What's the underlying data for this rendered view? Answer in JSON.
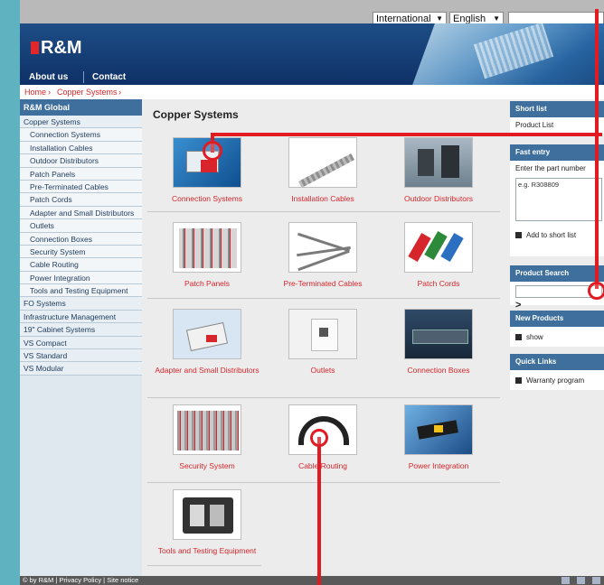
{
  "top_bar": {
    "language_region": "International",
    "language": "English"
  },
  "header": {
    "logo": "R&M",
    "nav": [
      "About us",
      "Contact"
    ]
  },
  "breadcrumb": [
    "Home",
    "Copper Systems"
  ],
  "left_nav": {
    "title": "R&M Global",
    "items": [
      {
        "label": "Copper Systems",
        "level": 1
      },
      {
        "label": "Connection Systems",
        "level": 2
      },
      {
        "label": "Installation Cables",
        "level": 2
      },
      {
        "label": "Outdoor Distributors",
        "level": 2
      },
      {
        "label": "Patch Panels",
        "level": 2
      },
      {
        "label": "Pre-Terminated Cables",
        "level": 2
      },
      {
        "label": "Patch Cords",
        "level": 2
      },
      {
        "label": "Adapter and Small Distributors",
        "level": 2
      },
      {
        "label": "Outlets",
        "level": 2
      },
      {
        "label": "Connection Boxes",
        "level": 2
      },
      {
        "label": "Security System",
        "level": 2
      },
      {
        "label": "Cable Routing",
        "level": 2
      },
      {
        "label": "Power Integration",
        "level": 2
      },
      {
        "label": "Tools and Testing Equipment",
        "level": 2
      },
      {
        "label": "FO Systems",
        "level": 1
      },
      {
        "label": "Infrastructure Management",
        "level": 1
      },
      {
        "label": "19\" Cabinet Systems",
        "level": 1
      },
      {
        "label": "VS Compact",
        "level": 1
      },
      {
        "label": "VS Standard",
        "level": 1
      },
      {
        "label": "VS Modular",
        "level": 1
      }
    ]
  },
  "main": {
    "title": "Copper Systems",
    "products": [
      {
        "label": "Connection Systems"
      },
      {
        "label": "Installation Cables"
      },
      {
        "label": "Outdoor Distributors"
      },
      {
        "label": "Patch Panels"
      },
      {
        "label": "Pre-Terminated Cables"
      },
      {
        "label": "Patch Cords"
      },
      {
        "label": "Adapter and Small Distributors"
      },
      {
        "label": "Outlets"
      },
      {
        "label": "Connection Boxes"
      },
      {
        "label": "Security System"
      },
      {
        "label": "Cable Routing"
      },
      {
        "label": "Power Integration"
      },
      {
        "label": "Tools and Testing Equipment"
      }
    ]
  },
  "right": {
    "short_list": {
      "title": "Short list",
      "text": "Product List"
    },
    "fast_entry": {
      "title": "Fast entry",
      "text": "Enter the part number",
      "placeholder": "e.g. R308809",
      "add": "Add to short list"
    },
    "product_search": {
      "title": "Product Search",
      "go": ">"
    },
    "new_products": {
      "title": "New Products",
      "link": "show"
    },
    "quick_links": {
      "title": "Quick Links",
      "link": "Warranty program"
    }
  },
  "footer": {
    "text": "© by R&M | Privacy Policy | Site notice"
  },
  "colors": {
    "accent_red": "#e11b22",
    "nav_blue": "#3e6f9d",
    "link_red": "#d7262b"
  }
}
